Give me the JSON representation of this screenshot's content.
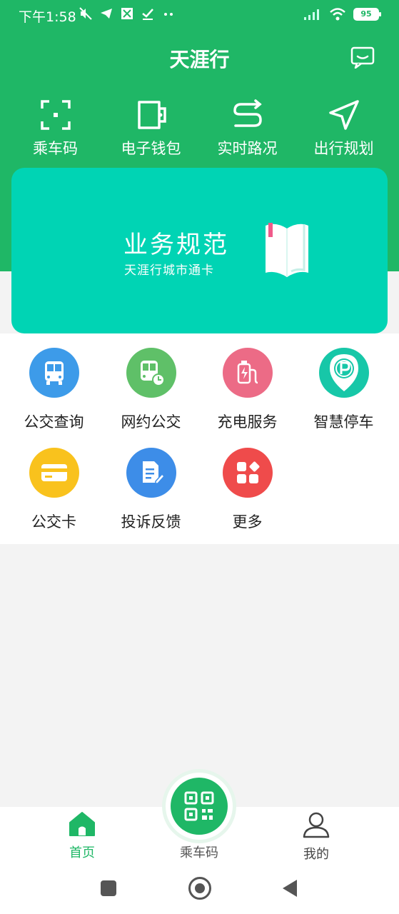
{
  "status_bar": {
    "time": "下午1:58",
    "battery": "95"
  },
  "header": {
    "title": "天涯行"
  },
  "quick_actions": [
    {
      "label": "乘车码",
      "icon": "scan-frame-icon"
    },
    {
      "label": "电子钱包",
      "icon": "wallet-icon"
    },
    {
      "label": "实时路况",
      "icon": "route-icon"
    },
    {
      "label": "出行规划",
      "icon": "navigation-arrow-icon"
    }
  ],
  "banner": {
    "title": "业务规范",
    "subtitle": "天涯行城市通卡"
  },
  "services": [
    {
      "label": "公交查询",
      "icon": "bus-icon",
      "color": "#3d9be9"
    },
    {
      "label": "网约公交",
      "icon": "bus-clock-icon",
      "color": "#5fc068"
    },
    {
      "label": "充电服务",
      "icon": "charging-icon",
      "color": "#ec6b86"
    },
    {
      "label": "智慧停车",
      "icon": "parking-pin-icon",
      "color": "#17c7a8"
    },
    {
      "label": "公交卡",
      "icon": "card-icon",
      "color": "#f9c21d"
    },
    {
      "label": "投诉反馈",
      "icon": "document-edit-icon",
      "color": "#3d8de8"
    },
    {
      "label": "更多",
      "icon": "apps-grid-icon",
      "color": "#ef4b4b"
    }
  ],
  "bottom_nav": {
    "home": "首页",
    "center": "乘车码",
    "mine": "我的",
    "active_color": "#1fb766"
  }
}
